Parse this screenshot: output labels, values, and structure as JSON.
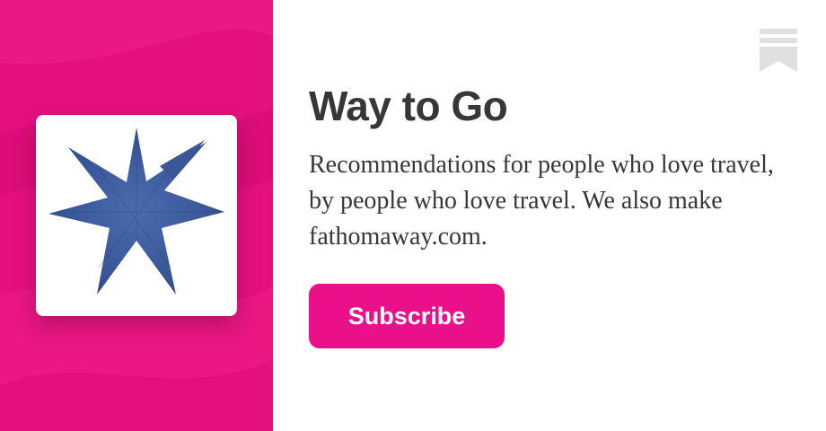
{
  "publication": {
    "title": "Way to Go",
    "description": "Recommendations for people who love travel, by people who love travel. We also make fathomaway.com.",
    "logo_icon": "blue-star-icon"
  },
  "actions": {
    "subscribe_label": "Subscribe"
  },
  "header": {
    "bookmark_icon": "bookmark-icon"
  },
  "colors": {
    "brand": "#e5107f",
    "button": "#e9108a",
    "text": "#363737",
    "star": "#3b5a9a",
    "bookmark": "#e0e0e0"
  }
}
